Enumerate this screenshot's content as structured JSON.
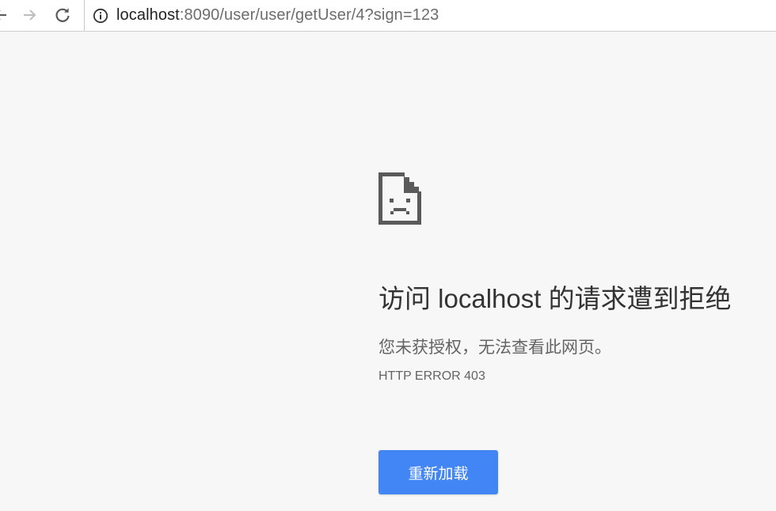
{
  "browser": {
    "address_bar": {
      "host": "localhost",
      "rest": ":8090/user/user/getUser/4?sign=123"
    },
    "icons": {
      "back": "arrow-left-icon",
      "forward": "arrow-right-icon",
      "reload": "reload-icon",
      "info": "info-icon"
    }
  },
  "error_page": {
    "title": "访问 localhost 的请求遭到拒绝",
    "description": "您未获授权，无法查看此网页。",
    "error_code": "HTTP ERROR 403",
    "reload_button_label": "重新加载",
    "icon": "sad-page-icon"
  },
  "colors": {
    "background": "#f7f7f7",
    "button": "#4285f4",
    "title_text": "#333333",
    "secondary_text": "#646464"
  }
}
